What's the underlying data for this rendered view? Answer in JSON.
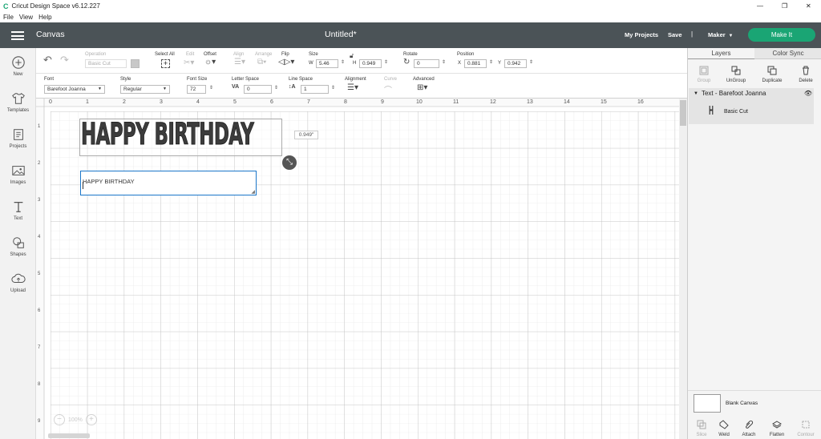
{
  "window": {
    "title": "Cricut Design Space  v6.12.227",
    "minimize": "—",
    "maximize": "❐",
    "close": "✕"
  },
  "menu": [
    "File",
    "View",
    "Help"
  ],
  "header": {
    "section": "Canvas",
    "doc_title": "Untitled*",
    "my_projects": "My Projects",
    "save": "Save",
    "divider": "|",
    "machine": "Maker",
    "make_it": "Make It"
  },
  "nav": [
    {
      "label": "New",
      "icon": "plus-circle-icon"
    },
    {
      "label": "Templates",
      "icon": "shirt-icon"
    },
    {
      "label": "Projects",
      "icon": "projects-icon"
    },
    {
      "label": "Images",
      "icon": "image-icon"
    },
    {
      "label": "Text",
      "icon": "text-icon"
    },
    {
      "label": "Shapes",
      "icon": "shapes-icon"
    },
    {
      "label": "Upload",
      "icon": "cloud-upload-icon"
    }
  ],
  "toolbar1": {
    "operation_label": "Operation",
    "operation_value": "Basic Cut",
    "select_all": "Select All",
    "edit": "Edit",
    "offset": "Offset",
    "align": "Align",
    "arrange": "Arrange",
    "flip": "Flip",
    "size_label": "Size",
    "w_label": "W",
    "w_value": "5.46",
    "h_label": "H",
    "h_value": "0.949",
    "rotate_label": "Rotate",
    "rotate_value": "0",
    "position_label": "Position",
    "x_label": "X",
    "x_value": "0.881",
    "y_label": "Y",
    "y_value": "0.942"
  },
  "toolbar2": {
    "font_label": "Font",
    "font_value": "Barefoot Joanna",
    "style_label": "Style",
    "style_value": "Regular",
    "font_size_label": "Font Size",
    "font_size_value": "72",
    "letter_space_label": "Letter Space",
    "letter_space_value": "0",
    "line_space_label": "Line Space",
    "line_space_value": "1",
    "alignment_label": "Alignment",
    "curve_label": "Curve",
    "advanced_label": "Advanced"
  },
  "canvas": {
    "ruler_top": [
      "0",
      "1",
      "2",
      "3",
      "4",
      "5",
      "6",
      "7",
      "8",
      "9",
      "10",
      "11",
      "12",
      "13",
      "14",
      "15",
      "16"
    ],
    "ruler_left": [
      "1",
      "2",
      "3",
      "4",
      "5",
      "6",
      "7",
      "8",
      "9"
    ],
    "text_object": "HAPPY BIRTHDAY",
    "height_tooltip": "0.949\"",
    "text_box_value": "HAPPY BIRTHDAY",
    "zoom": "100%"
  },
  "right_panel": {
    "tab_layers": "Layers",
    "tab_color_sync": "Color Sync",
    "tools": [
      "Group",
      "UnGroup",
      "Duplicate",
      "Delete"
    ],
    "layer_group": "Text - Barefoot Joanna",
    "layer_item": "Basic Cut",
    "layer_glyph": "H",
    "blank_canvas": "Blank Canvas",
    "bottom_tools": [
      "Slice",
      "Weld",
      "Attach",
      "Flatten",
      "Contour"
    ]
  },
  "colors": {
    "header_bg": "#4b5357",
    "make_it": "#1aa574",
    "selection": "#1b76c9"
  }
}
